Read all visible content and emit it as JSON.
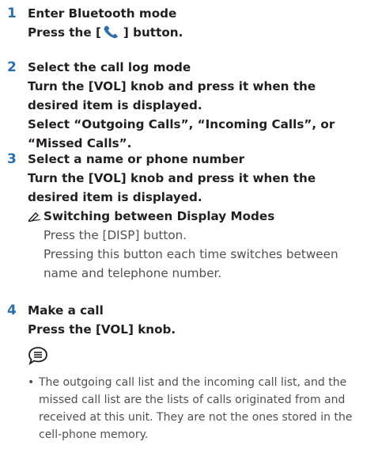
{
  "steps": [
    {
      "number": "1",
      "title": "Enter Bluetooth mode",
      "line_a": "Press the [",
      "line_b": "] button.",
      "icon": "phone-icon"
    },
    {
      "number": "2",
      "title": "Select the call log mode",
      "lines": [
        "Turn the [VOL] knob and press it when the",
        "desired item is displayed.",
        "Select “Outgoing Calls”, “Incoming Calls”, or",
        "“Missed Calls”."
      ]
    },
    {
      "number": "3",
      "title": "Select a name or phone number",
      "lines": [
        "Turn the [VOL] knob and press it when the",
        "desired item is displayed."
      ],
      "sub_title": "Switching between Display Modes",
      "sub_icon": "pencil-note-icon",
      "sub_lines": [
        "Press the [DISP] button.",
        "Pressing this button each time switches between",
        "name and telephone number."
      ]
    },
    {
      "number": "4",
      "title": "Make a call",
      "lines": [
        "Press the [VOL] knob."
      ]
    }
  ],
  "note": {
    "icon": "note-speech-icon",
    "bullet": "•",
    "lines": [
      "The outgoing call list and the incoming call list, and the",
      "missed call list are the lists of calls originated from and",
      "received at this unit. They are not the ones stored in the",
      "cell-phone memory."
    ]
  }
}
